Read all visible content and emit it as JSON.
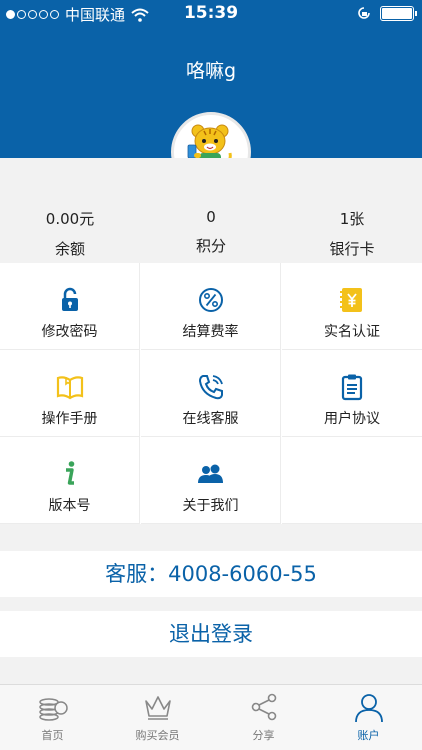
{
  "status_bar": {
    "carrier": "中国联通",
    "time": "15:39"
  },
  "header": {
    "username": "咯嘛g"
  },
  "stats": [
    {
      "value": "0.00元",
      "label": "余额"
    },
    {
      "value": "0",
      "label": "积分"
    },
    {
      "value": "1张",
      "label": "银行卡"
    }
  ],
  "menu": [
    {
      "label": "修改密码",
      "icon": "lock-icon"
    },
    {
      "label": "结算费率",
      "icon": "percent-icon"
    },
    {
      "label": "实名认证",
      "icon": "id-card-icon"
    },
    {
      "label": "操作手册",
      "icon": "book-icon"
    },
    {
      "label": "在线客服",
      "icon": "phone-icon"
    },
    {
      "label": "用户协议",
      "icon": "clipboard-icon"
    },
    {
      "label": "版本号",
      "icon": "info-icon"
    },
    {
      "label": "关于我们",
      "icon": "users-icon"
    }
  ],
  "service_line": "客服：4008-6060-55",
  "logout_label": "退出登录",
  "tabs": [
    {
      "label": "首页",
      "icon": "coins-icon"
    },
    {
      "label": "购买会员",
      "icon": "crown-icon"
    },
    {
      "label": "分享",
      "icon": "share-icon"
    },
    {
      "label": "账户",
      "icon": "user-icon"
    }
  ],
  "colors": {
    "brand": "#0a62a8",
    "gold": "#f3c11a",
    "green": "#3aa45a"
  }
}
